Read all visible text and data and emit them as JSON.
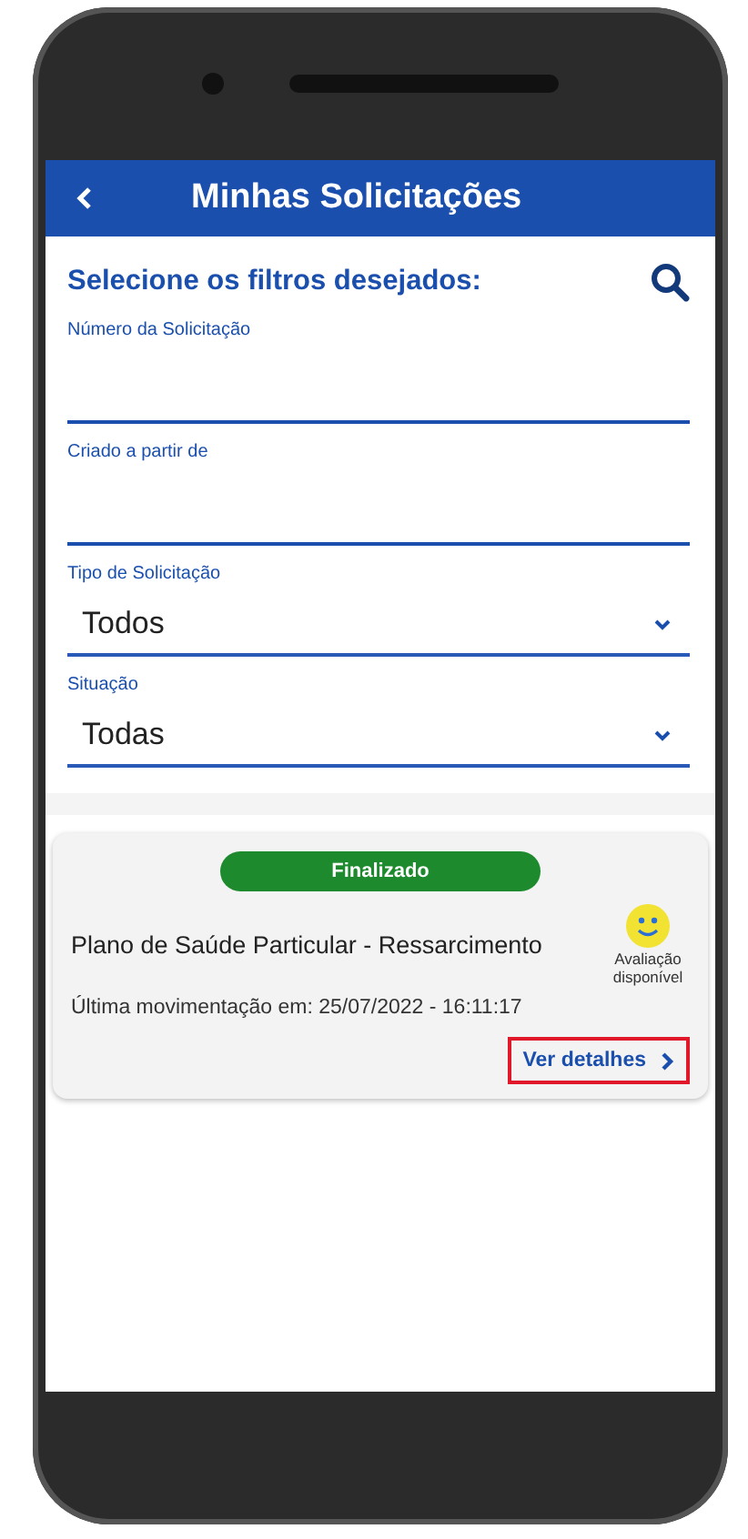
{
  "header": {
    "title": "Minhas Solicitações"
  },
  "filters": {
    "heading": "Selecione os filtros desejados:",
    "fields": [
      {
        "kind": "text",
        "label": "Número da Solicitação"
      },
      {
        "kind": "text",
        "label": "Criado a partir de"
      },
      {
        "kind": "select",
        "label": "Tipo de Solicitação",
        "value": "Todos"
      },
      {
        "kind": "select",
        "label": "Situação",
        "value": "Todas"
      }
    ]
  },
  "requests": [
    {
      "status": "Finalizado",
      "color": "#1e8a2e",
      "title": "Plano de Saúde Particular - Ressarcimento",
      "rating_label": "Avaliação disponível",
      "last_update": "Última movimentação em: 25/07/2022 - 16:11:17",
      "link": "Ver detalhes",
      "highlighted": true
    }
  ]
}
